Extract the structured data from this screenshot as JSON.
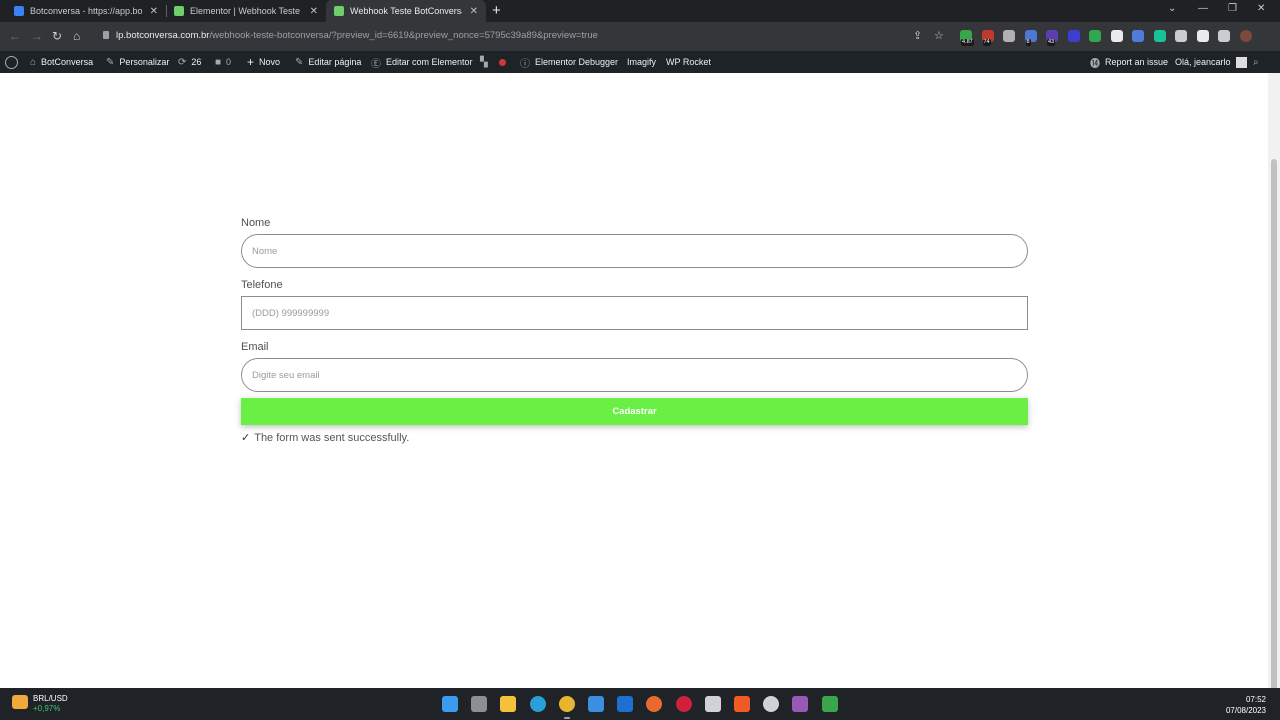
{
  "browser": {
    "tabs": [
      {
        "title": "Botconversa - https://app.botcon",
        "active": false,
        "favicon_color": "#3b82f6"
      },
      {
        "title": "Elementor | Webhook Teste BotC",
        "active": false,
        "favicon_color": "#6fd06a"
      },
      {
        "title": "Webhook Teste BotConversa - Bo",
        "active": true,
        "favicon_color": "#6fd06a"
      }
    ],
    "new_tab": "+",
    "window_controls": {
      "chevron": "⌄",
      "minimize": "—",
      "restore": "❐",
      "close": "✕"
    },
    "nav": {
      "back": "←",
      "forward": "→",
      "reload": "↻",
      "home": "⌂"
    },
    "address": {
      "host": "lp.botconversa.com.br",
      "path": "/webhook-teste-botconversa/?preview_id=6619&preview_nonce=5795c39a89&preview=true"
    },
    "toolbar_icons": {
      "share": "⇪",
      "star": "☆"
    },
    "extensions": [
      {
        "name": "extension-icon",
        "color": "#37a84a",
        "badge": "4.87"
      },
      {
        "name": "extension-icon",
        "color": "#c0392b",
        "badge": "74"
      },
      {
        "name": "extension-icon",
        "color": "#b0b0b0",
        "badge": ""
      },
      {
        "name": "extension-icon",
        "color": "#4a78d4",
        "badge": "8"
      },
      {
        "name": "extension-icon",
        "color": "#5b3fb0",
        "badge": "43"
      },
      {
        "name": "extension-icon",
        "color": "#3a3fd1",
        "badge": ""
      },
      {
        "name": "extension-icon",
        "color": "#2fa84f",
        "badge": ""
      },
      {
        "name": "extension-icon",
        "color": "#e8eaed",
        "badge": ""
      },
      {
        "name": "extension-icon",
        "color": "#4f7dd9",
        "badge": ""
      },
      {
        "name": "extension-icon",
        "color": "#18c39a",
        "badge": ""
      },
      {
        "name": "puzzle-icon",
        "color": "#c9ccd0",
        "badge": ""
      },
      {
        "name": "google-icon",
        "color": "#e8eaed",
        "badge": ""
      },
      {
        "name": "sidepanel-icon",
        "color": "#c9ccd0",
        "badge": ""
      },
      {
        "name": "profile-avatar-icon",
        "color": "#7a4a3a",
        "badge": ""
      }
    ]
  },
  "adminbar": {
    "site_name": "BotConversa",
    "customize": "Personalizar",
    "updates_count": "26",
    "comments_count": "0",
    "new": "Novo",
    "edit_page": "Editar página",
    "edit_elementor": "Editar com Elementor",
    "elementor_debugger": "Elementor Debugger",
    "imagify": "Imagify",
    "wp_rocket": "WP Rocket",
    "report_issue": "Report an issue",
    "greeting": "Olá, jeancarlo"
  },
  "form": {
    "name_label": "Nome",
    "name_placeholder": "Nome",
    "phone_label": "Telefone",
    "phone_placeholder": "(DDD) 999999999",
    "email_label": "Email",
    "email_placeholder": "Digite seu email",
    "submit_label": "Cadastrar",
    "success_message": "The form was sent successfully.",
    "accent_color": "#6aef44"
  },
  "taskbar": {
    "ticker_name": "BRL/USD",
    "ticker_change": "+0,97%",
    "time": "07:52",
    "date": "07/08/2023",
    "apps": [
      {
        "name": "start-icon",
        "color": "#3a9bf0"
      },
      {
        "name": "task-view-icon",
        "color": "#8c8f94"
      },
      {
        "name": "file-explorer-icon",
        "color": "#f3c13a"
      },
      {
        "name": "edge-icon",
        "color": "#2aa0d8"
      },
      {
        "name": "chrome-icon",
        "color": "#e8b530"
      },
      {
        "name": "store-icon",
        "color": "#3b8ee0"
      },
      {
        "name": "trello-icon",
        "color": "#1f6fd0"
      },
      {
        "name": "firefox-icon",
        "color": "#e66b2c"
      },
      {
        "name": "opera-icon",
        "color": "#d2203a"
      },
      {
        "name": "vpn-icon",
        "color": "#cfd3d8"
      },
      {
        "name": "postman-icon",
        "color": "#ef5b25"
      },
      {
        "name": "github-icon",
        "color": "#cfd3d8"
      },
      {
        "name": "colorful-app-icon",
        "color": "#9b59b6"
      },
      {
        "name": "green-app-icon",
        "color": "#3aa64a"
      }
    ]
  }
}
